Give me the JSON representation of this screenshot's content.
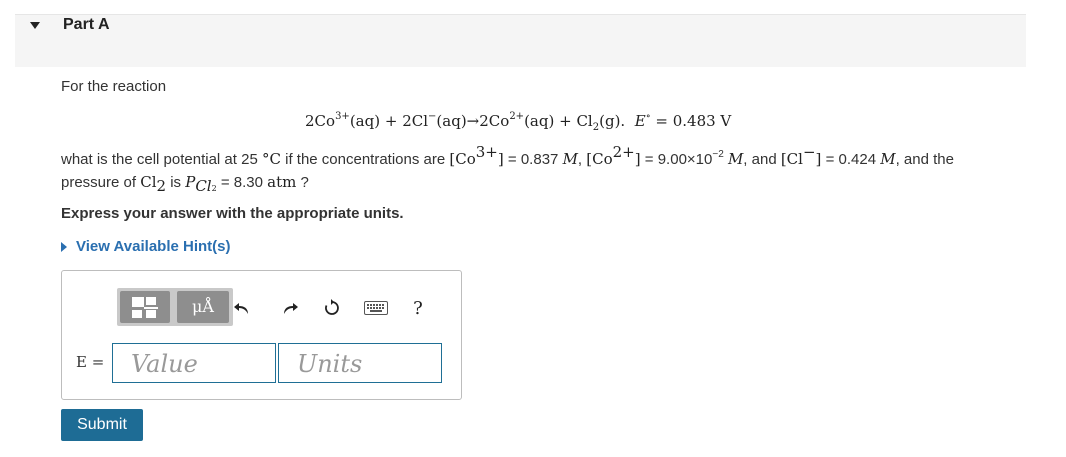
{
  "part": {
    "title": "Part A"
  },
  "question": {
    "intro": "For the reaction",
    "equation": {
      "r1": "2Co",
      "r1_sup": "3+",
      "r1_phase": "(aq)",
      "plus1": "+",
      "r2": "2Cl",
      "r2_sup": "−",
      "r2_phase": "(aq)",
      "arrow": "→",
      "p1": "2Co",
      "p1_sup": "2+",
      "p1_phase": "(aq)",
      "plus2": "+",
      "p2": "Cl",
      "p2_sub": "2",
      "p2_phase": "(g).",
      "e_label": "E",
      "e_sup": "∘",
      "e_value": "= 0.483 V"
    },
    "line1": {
      "t1": "what is the cell potential at 25 ",
      "deg": "°C",
      "t2": " if the concentrations are ",
      "co3": "[Co",
      "co3_sup": "3+",
      "co3_close": "]",
      "co3_val": " = 0.837 ",
      "m1": "M",
      "t3": ", ",
      "co2": "[Co",
      "co2_sup": "2+",
      "co2_close": "]",
      "co2_val": " = 9.00×10",
      "co2_exp": "−2",
      "m2": "M",
      "t4": ", and ",
      "cl": "[Cl",
      "cl_sup": "−",
      "cl_close": "]",
      "cl_val": " = 0.424 ",
      "m3": "M",
      "t5": ", and the"
    },
    "line2": {
      "t1": "pressure of ",
      "cl2": "Cl",
      "cl2_sub": "2",
      "t2": " is ",
      "p": "P",
      "p_sub": "Cl",
      "p_sub2": "2",
      "val": " = 8.30 ",
      "unit": "atm",
      "end": " ?"
    },
    "instruction": "Express your answer with the appropriate units.",
    "hint_link": "View Available Hint(s)"
  },
  "toolbar": {
    "templates_icon": "fraction-template-icon",
    "units_label": "μÅ",
    "undo_icon": "undo-icon",
    "redo_icon": "redo-icon",
    "reset_icon": "reset-icon",
    "keyboard_icon": "keyboard-icon",
    "help_label": "?"
  },
  "answer": {
    "label": "E =",
    "value_placeholder": "Value",
    "units_placeholder": "Units"
  },
  "submit_label": "Submit",
  "colors": {
    "link": "#2a6fb0",
    "submit_bg": "#1e6c95",
    "field_border": "#1f6f95",
    "header_bg": "#f5f5f5"
  }
}
